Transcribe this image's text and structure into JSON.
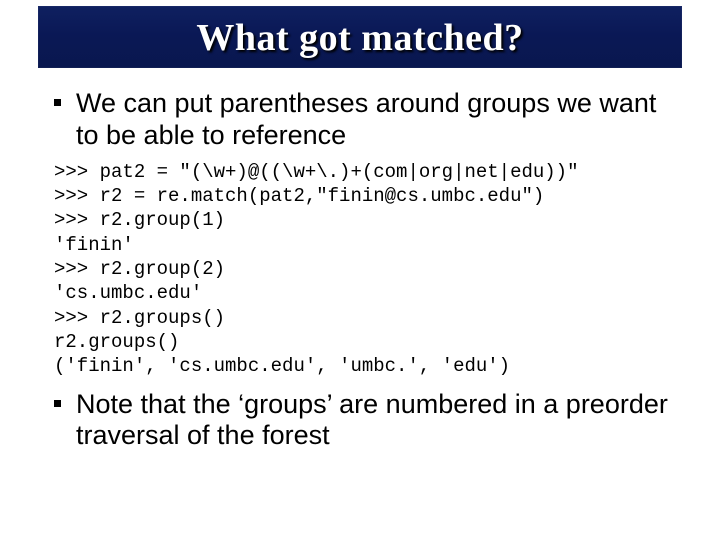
{
  "title": "What got matched?",
  "bullets": {
    "item1": "We can put parentheses around groups we want to be able to reference",
    "item2": "Note that the ‘groups’ are numbered in a preorder traversal of the forest"
  },
  "code_lines": [
    ">>> pat2 = \"(\\w+)@((\\w+\\.)+(com|org|net|edu))\"",
    ">>> r2 = re.match(pat2,\"finin@cs.umbc.edu\")",
    ">>> r2.group(1)",
    "'finin'",
    ">>> r2.group(2)",
    "'cs.umbc.edu'",
    ">>> r2.groups()",
    "r2.groups()",
    "('finin', 'cs.umbc.edu', 'umbc.', 'edu')"
  ]
}
